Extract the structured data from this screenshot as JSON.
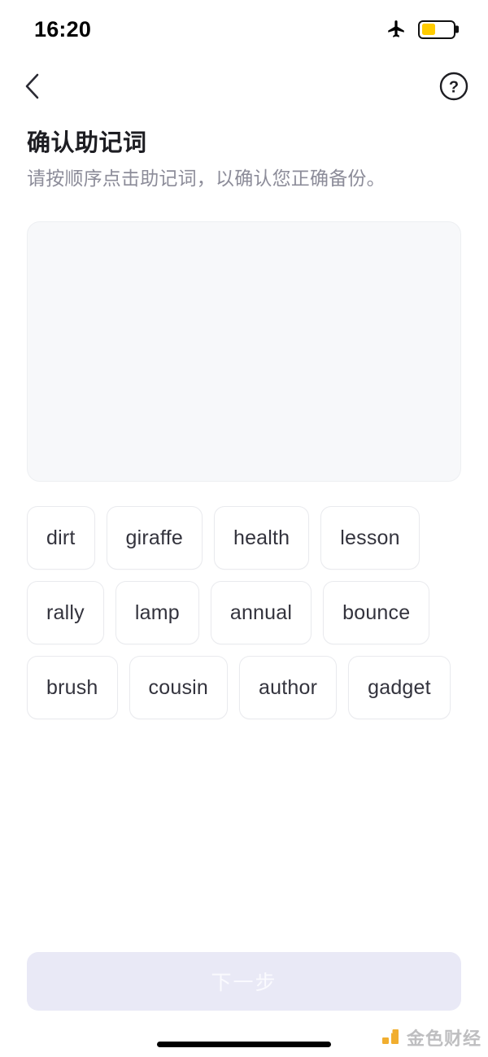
{
  "status_bar": {
    "time": "16:20",
    "airplane_icon": "airplane-mode-icon",
    "battery_icon": "battery-icon",
    "battery_level_percent": 45,
    "battery_color": "#FFCC00"
  },
  "nav_bar": {
    "back_icon": "chevron-left-icon",
    "help_icon": "question-mark-circle-icon"
  },
  "heading": {
    "title": "确认助记词",
    "subtitle": "请按顺序点击助记词，以确认您正确备份。"
  },
  "dropzone": {
    "selected_words": []
  },
  "word_bank": {
    "words": [
      "dirt",
      "giraffe",
      "health",
      "lesson",
      "rally",
      "lamp",
      "annual",
      "bounce",
      "brush",
      "cousin",
      "author",
      "gadget"
    ]
  },
  "footer": {
    "next_button_label": "下一步",
    "next_button_disabled": true,
    "next_button_bg": "#E9E9F6"
  },
  "watermark": {
    "text": "金色财经",
    "logo_icon": "jinse-logo-icon",
    "logo_color": "#F0A81E"
  }
}
